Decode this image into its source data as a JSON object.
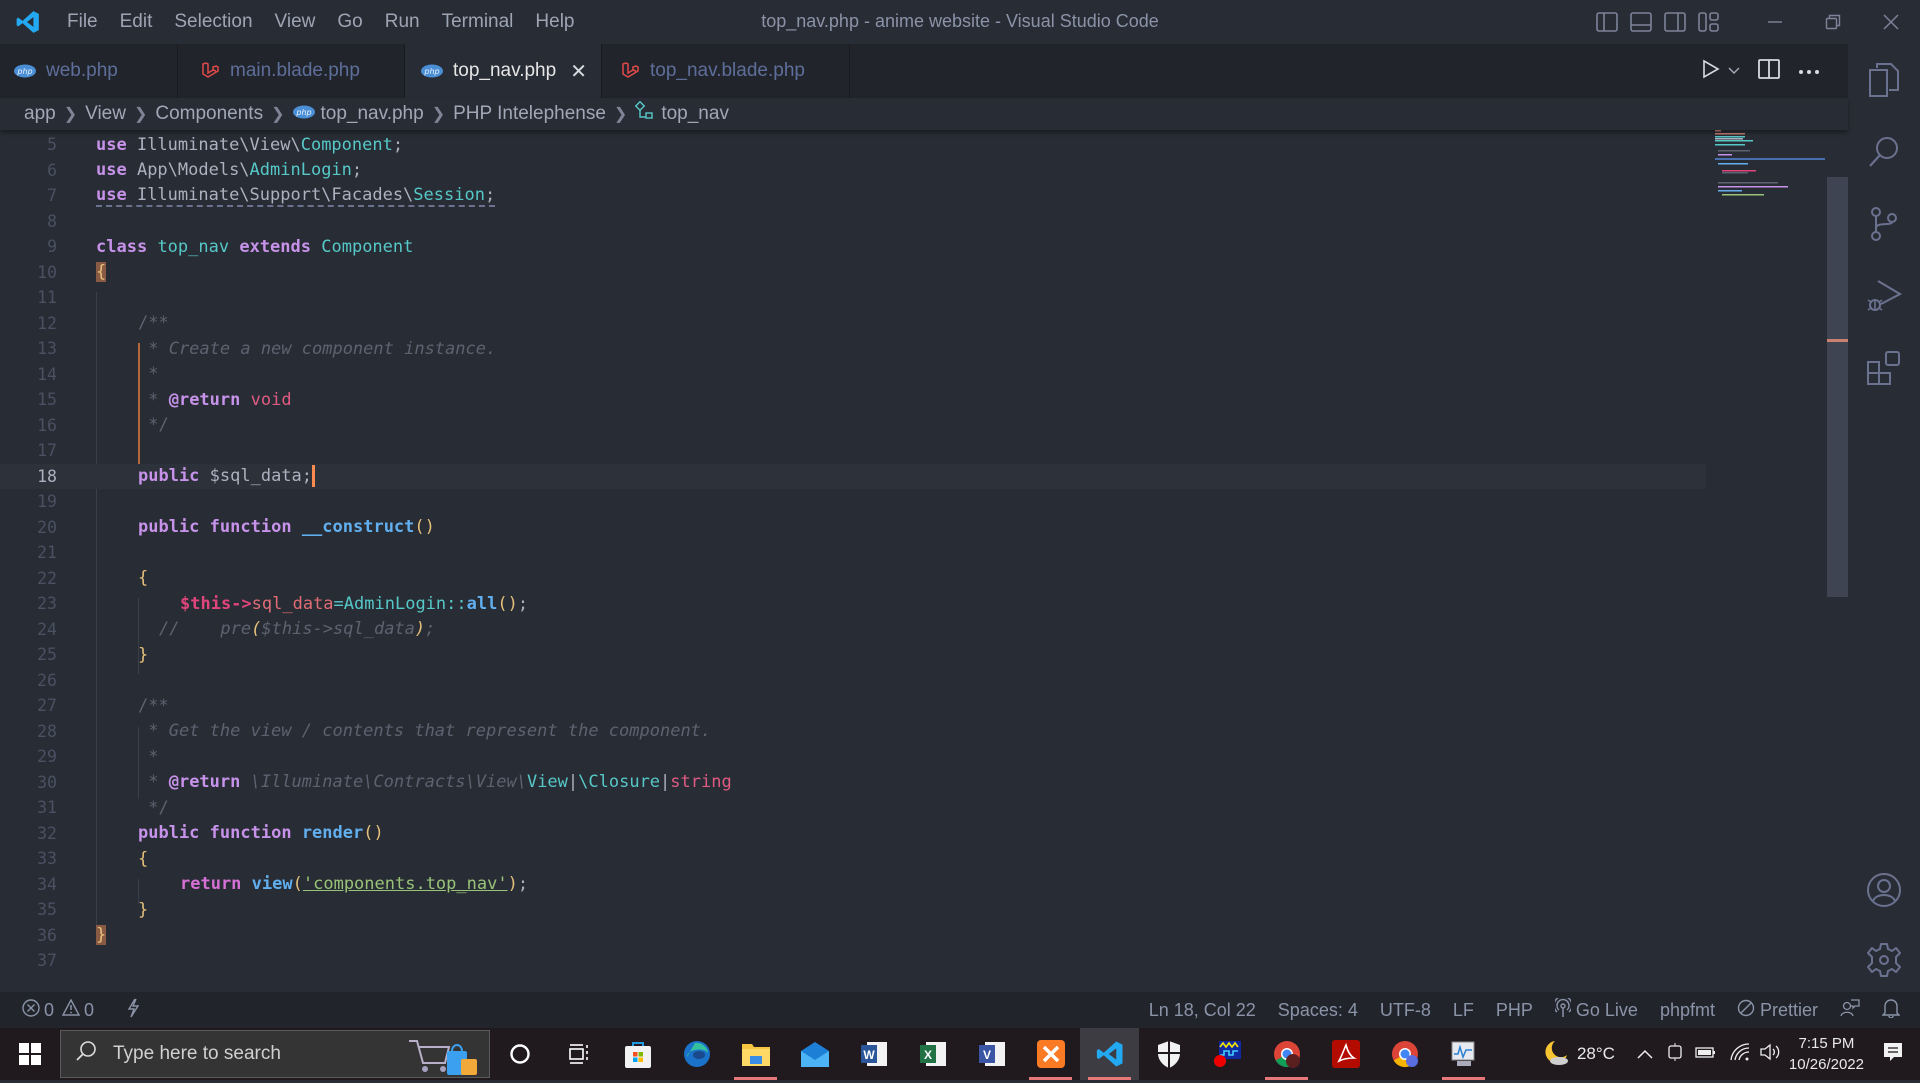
{
  "window": {
    "title": "top_nav.php - anime website - Visual Studio Code",
    "menu": [
      "File",
      "Edit",
      "Selection",
      "View",
      "Go",
      "Run",
      "Terminal",
      "Help"
    ]
  },
  "tabs": [
    {
      "label": "web.php",
      "icon": "php-icon",
      "active": false
    },
    {
      "label": "main.blade.php",
      "icon": "laravel-icon",
      "active": false
    },
    {
      "label": "top_nav.php",
      "icon": "php-icon",
      "active": true
    },
    {
      "label": "top_nav.blade.php",
      "icon": "laravel-icon",
      "active": false
    }
  ],
  "breadcrumb": [
    "app",
    "View",
    "Components",
    "top_nav.php",
    "PHP Intelephense",
    "top_nav"
  ],
  "editor": {
    "current_line": 18,
    "line_numbers": [
      "5",
      "6",
      "7",
      "8",
      "9",
      "10",
      "11",
      "12",
      "13",
      "14",
      "15",
      "16",
      "17",
      "18",
      "19",
      "20",
      "21",
      "22",
      "23",
      "24",
      "25",
      "26",
      "27",
      "28",
      "29",
      "30",
      "31",
      "32",
      "33",
      "34",
      "35",
      "36",
      "37"
    ],
    "code": {
      "l5": [
        "use",
        " Illuminate\\View\\",
        "Component",
        ";"
      ],
      "l6": [
        "use",
        " App\\Models\\",
        "AdminLogin",
        ";"
      ],
      "l7": [
        "use",
        " Illuminate\\Support\\Facades\\",
        "Session",
        ";"
      ],
      "l9": [
        "class",
        " ",
        "top_nav",
        " ",
        "extends",
        " ",
        "Component"
      ],
      "l10": "{",
      "l12": "/**",
      "l13": " * Create a new component instance.",
      "l14": " *",
      "l15": [
        " * ",
        "@return",
        " ",
        "void"
      ],
      "l16": " */",
      "l18": [
        "public",
        " $sql_data;"
      ],
      "l20": [
        "public",
        " ",
        "function",
        " ",
        "__construct",
        "()"
      ],
      "l22": "{",
      "l23": [
        "$this->",
        "sql_data",
        "=",
        "AdminLogin",
        "::",
        "all",
        "()",
        ";"
      ],
      "l24": [
        "//    pre",
        "(",
        "$this->sql_data",
        ")",
        ";"
      ],
      "l25": "}",
      "l27": "/**",
      "l28": " * Get the view / contents that represent the component.",
      "l29": " *",
      "l30": [
        " * ",
        "@return",
        " \\Illuminate\\Contracts\\View\\",
        "View",
        "|",
        "\\Closure",
        "|",
        "string"
      ],
      "l31": " */",
      "l32": [
        "public",
        " ",
        "function",
        " ",
        "render",
        "()"
      ],
      "l33": "{",
      "l34": [
        "return",
        " ",
        "view",
        "(",
        "'components.top_nav'",
        ")",
        ";"
      ],
      "l35": "}",
      "l36": "}"
    }
  },
  "statusbar": {
    "errors": "0",
    "warnings": "0",
    "position": "Ln 18, Col 22",
    "spaces": "Spaces: 4",
    "encoding": "UTF-8",
    "eol": "LF",
    "language": "PHP",
    "golive": "Go Live",
    "formatter": "phpfmt",
    "prettier": "Prettier"
  },
  "taskbar": {
    "search_placeholder": "Type here to search",
    "weather": "28°C",
    "time": "7:15 PM",
    "date": "10/26/2022",
    "apps": [
      "Cortana",
      "Task View",
      "Microsoft Store",
      "Microsoft Edge",
      "File Explorer",
      "Mail",
      "Word",
      "Excel",
      "Visio",
      "XAMPP",
      "Visual Studio Code",
      "Windows Security",
      "Monitor App",
      "Google Chrome",
      "Adobe Acrobat",
      "Google Chrome Profile",
      "Performance Monitor"
    ]
  }
}
